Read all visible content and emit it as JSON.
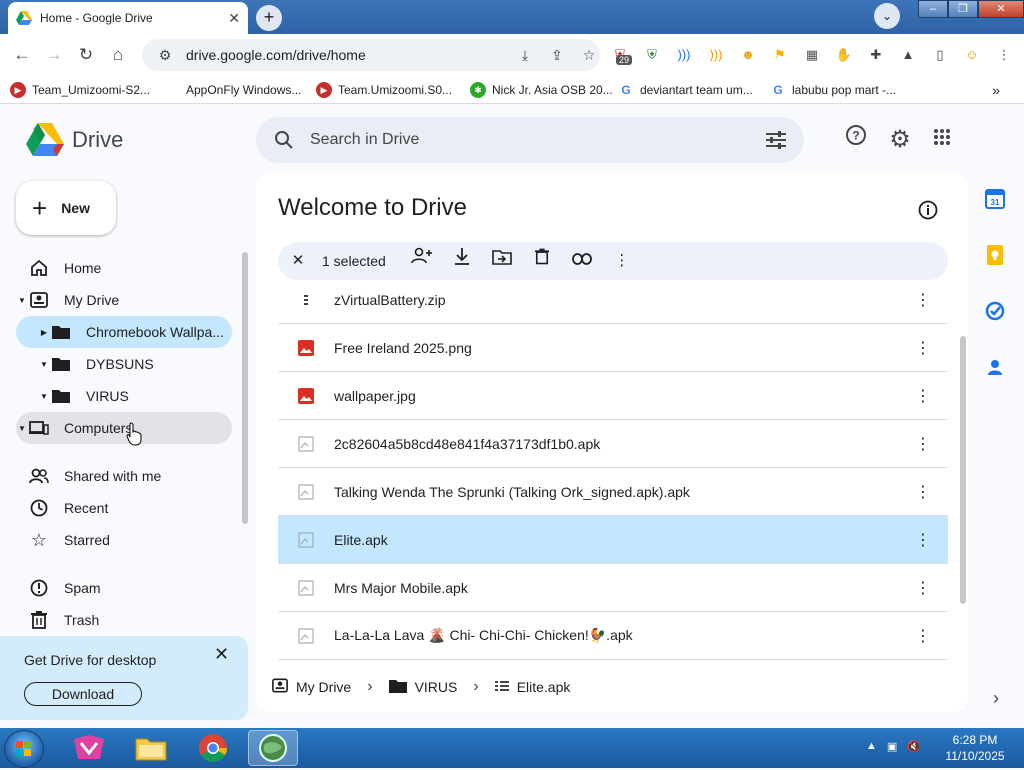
{
  "browser": {
    "tab_title": "Home - Google Drive",
    "new_tab_symbol": "+",
    "url": "drive.google.com/drive/home",
    "extension_badge": "29",
    "window_controls": [
      "–",
      "❐",
      "✕"
    ]
  },
  "bookmarks": [
    {
      "label": "Team_Umizoomi-S2...",
      "icon": "youtube-icon",
      "color": "#c4302b"
    },
    {
      "label": "AppOnFly Windows...",
      "icon": "blank-icon",
      "color": "#ffffff"
    },
    {
      "label": "Team.Umizoomi.S0...",
      "icon": "youtube-icon",
      "color": "#c4302b"
    },
    {
      "label": "Nick Jr. Asia OSB 20...",
      "icon": "nick-icon",
      "color": "#2aa82a"
    },
    {
      "label": "deviantart team um...",
      "icon": "google-icon",
      "color": "#4285f4"
    },
    {
      "label": "labubu pop mart -...",
      "icon": "google-icon",
      "color": "#4285f4"
    }
  ],
  "drive": {
    "app_name": "Drive",
    "search_placeholder": "Search in Drive",
    "new_label": "New",
    "nav": {
      "home": "Home",
      "my_drive": "My Drive",
      "chromebook": "Chromebook Wallpa...",
      "dybsuns": "DYBSUNS",
      "virus": "VIRUS",
      "computers": "Computers",
      "shared": "Shared with me",
      "recent": "Recent",
      "starred": "Starred",
      "spam": "Spam",
      "trash": "Trash"
    },
    "promo": {
      "title": "Get Drive for desktop",
      "button": "Download"
    },
    "welcome": "Welcome to Drive",
    "selection": {
      "count": "1 selected"
    },
    "files": [
      {
        "name": "zVirtualBattery.zip",
        "type": "zip",
        "selected": false
      },
      {
        "name": "Free Ireland 2025.png",
        "type": "image",
        "selected": false
      },
      {
        "name": "wallpaper.jpg",
        "type": "image",
        "selected": false
      },
      {
        "name": "2c82604a5b8cd48e841f4a37173df1b0.apk",
        "type": "broken",
        "selected": false
      },
      {
        "name": "Talking Wenda The Sprunki (Talking Ork_signed.apk).apk",
        "type": "broken",
        "selected": false
      },
      {
        "name": "Elite.apk",
        "type": "broken",
        "selected": true
      },
      {
        "name": "Mrs Major Mobile.apk",
        "type": "broken",
        "selected": false
      },
      {
        "name": "La-La-La Lava 🌋 Chi- Chi-Chi- Chicken!🐓.apk",
        "type": "broken",
        "selected": false
      }
    ],
    "breadcrumb": {
      "root": "My Drive",
      "folder": "VIRUS",
      "file": "Elite.apk"
    }
  },
  "taskbar": {
    "time": "6:28 PM",
    "date": "11/10/2025"
  },
  "colors": {
    "selected_row": "#c2e7ff",
    "drive_blue": "#0b57d0",
    "image_red": "#d93025"
  }
}
